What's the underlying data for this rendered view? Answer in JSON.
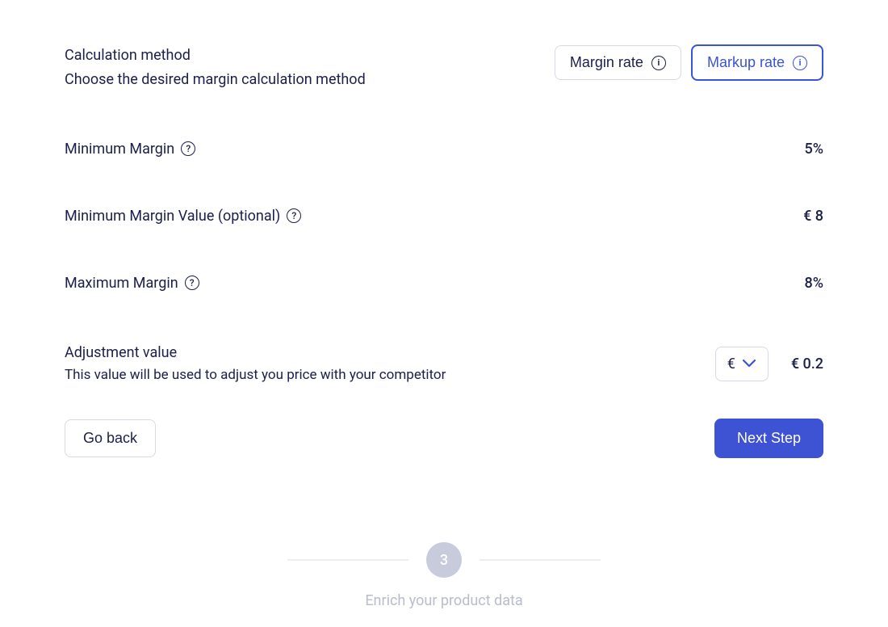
{
  "calc_method": {
    "title": "Calculation method",
    "desc": "Choose the desired margin calculation method",
    "options": {
      "margin_rate": "Margin rate",
      "markup_rate": "Markup rate"
    },
    "selected": "markup_rate"
  },
  "min_margin": {
    "label": "Minimum Margin",
    "value": "5%"
  },
  "min_margin_value": {
    "label": "Minimum Margin Value (optional)",
    "value": "€ 8"
  },
  "max_margin": {
    "label": "Maximum Margin",
    "value": "8%"
  },
  "adjustment": {
    "title": "Adjustment value",
    "desc": "This value will be used to adjust you price with your competitor",
    "currency_symbol": "€",
    "value": "€ 0.2"
  },
  "actions": {
    "go_back": "Go back",
    "next_step": "Next Step"
  },
  "stepper": {
    "number": "3",
    "caption": "Enrich your product data"
  }
}
